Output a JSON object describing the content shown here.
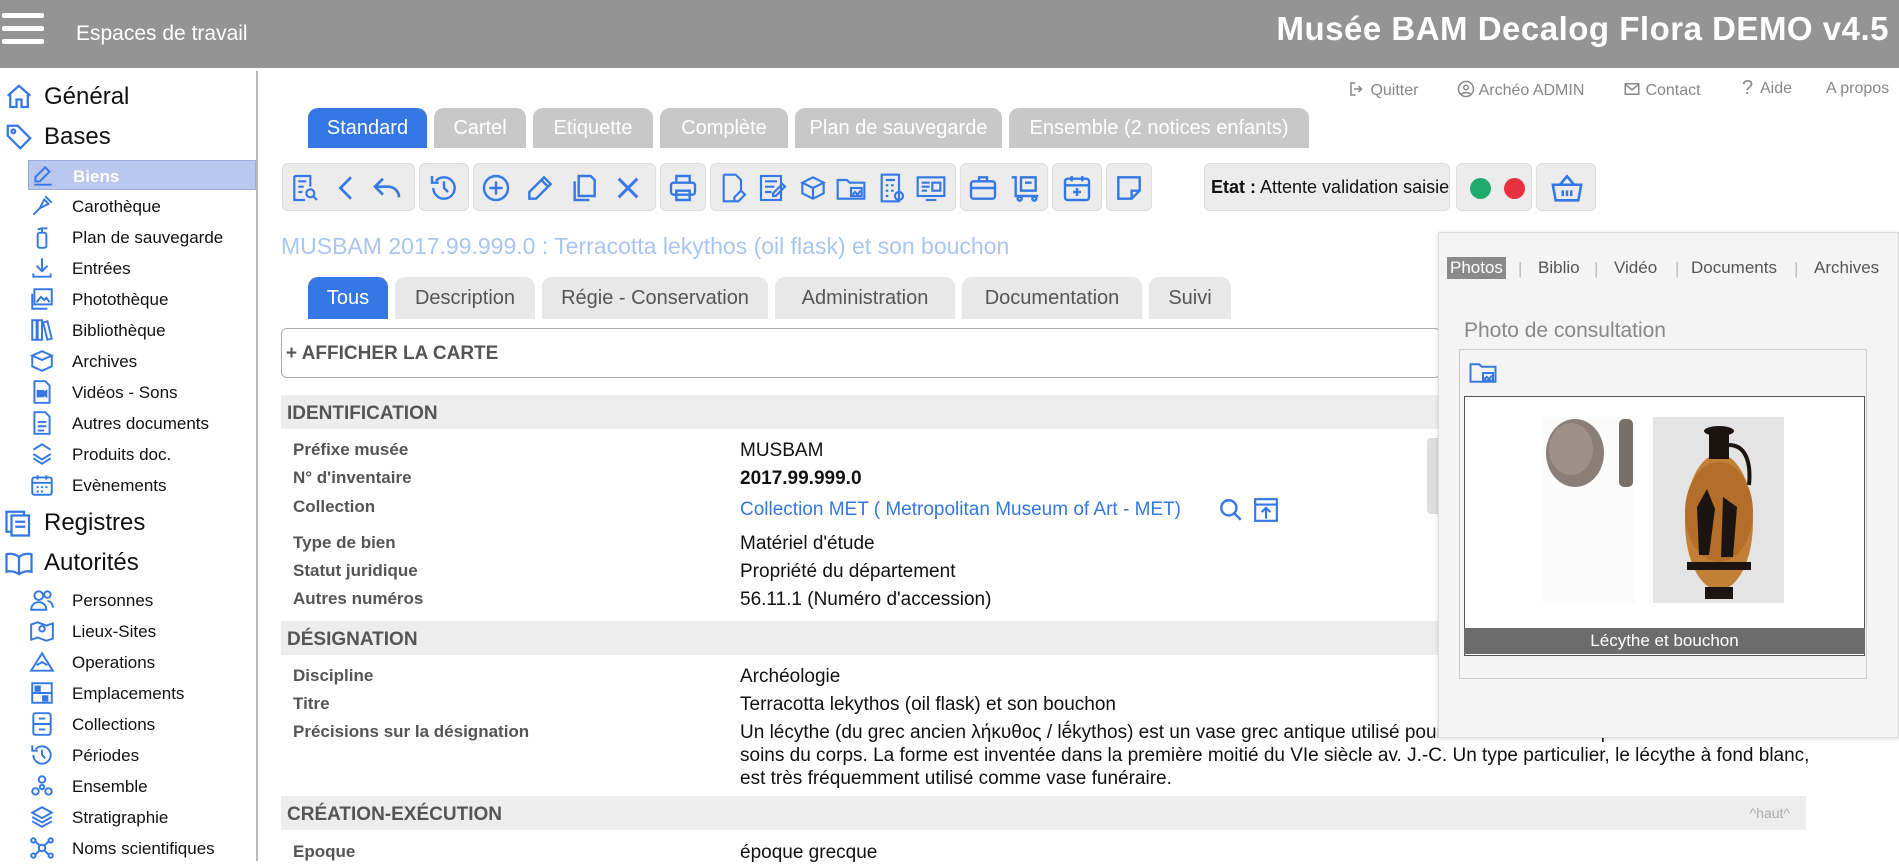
{
  "header": {
    "workspaces_label": "Espaces de travail",
    "app_title": "Musée BAM Decalog Flora DEMO v4.5"
  },
  "sidebar": {
    "sections": [
      {
        "label": "Général",
        "icon": "home-icon"
      },
      {
        "label": "Bases",
        "icon": "tag-icon"
      },
      {
        "label": "Registres",
        "icon": "registers-icon"
      },
      {
        "label": "Autorités",
        "icon": "book-open-icon"
      }
    ],
    "bases_items": [
      {
        "label": "Biens",
        "icon": "pen-edit-icon",
        "active": true
      },
      {
        "label": "Carothèque",
        "icon": "drill-icon"
      },
      {
        "label": "Plan de sauvegarde",
        "icon": "fire-extinguisher-icon"
      },
      {
        "label": "Entrées",
        "icon": "download-icon"
      },
      {
        "label": "Photothèque",
        "icon": "image-gallery-icon"
      },
      {
        "label": "Bibliothèque",
        "icon": "books-icon"
      },
      {
        "label": "Archives",
        "icon": "archive-box-icon"
      },
      {
        "label": "Vidéos - Sons",
        "icon": "video-file-icon"
      },
      {
        "label": "Autres documents",
        "icon": "document-icon"
      },
      {
        "label": "Produits doc.",
        "icon": "stack-icon"
      },
      {
        "label": "Evènements",
        "icon": "calendar-icon"
      }
    ],
    "autorites_items": [
      {
        "label": "Personnes",
        "icon": "people-icon"
      },
      {
        "label": "Lieux-Sites",
        "icon": "map-pin-icon"
      },
      {
        "label": "Operations",
        "icon": "excavation-icon"
      },
      {
        "label": "Emplacements",
        "icon": "shelves-icon"
      },
      {
        "label": "Collections",
        "icon": "cabinet-icon"
      },
      {
        "label": "Périodes",
        "icon": "history-icon"
      },
      {
        "label": "Ensemble",
        "icon": "cluster-icon"
      },
      {
        "label": "Stratigraphie",
        "icon": "layers-icon"
      },
      {
        "label": "Noms scientifiques",
        "icon": "network-icon"
      }
    ]
  },
  "top_links": {
    "quit": "Quitter",
    "user": "Archéo ADMIN",
    "contact": "Contact",
    "help": "Aide",
    "about": "A propos"
  },
  "view_tabs": [
    "Standard",
    "Cartel",
    "Etiquette",
    "Complète",
    "Plan de sauvegarde",
    "Ensemble (2 notices enfants)"
  ],
  "status": {
    "label": "Etat :",
    "value": "Attente validation saisie"
  },
  "record_title": "MUSBAM 2017.99.999.0 : Terracotta lekythos (oil flask) et son bouchon",
  "section_tabs": [
    "Tous",
    "Description",
    "Régie - Conservation",
    "Administration",
    "Documentation",
    "Suivi"
  ],
  "map_toggle": "+ AFFICHER LA CARTE",
  "identification": {
    "title": "IDENTIFICATION",
    "fields": [
      {
        "label": "Préfixe musée",
        "value": "MUSBAM"
      },
      {
        "label": "N° d'inventaire",
        "value": "2017.99.999.0"
      },
      {
        "label": "Collection",
        "value": "Collection MET ( Metropolitan Museum of Art - MET)"
      },
      {
        "label": "Type de bien",
        "value": "Matériel d'étude"
      },
      {
        "label": "Statut juridique",
        "value": "Propriété du département"
      },
      {
        "label": "Autres numéros",
        "value": "56.11.1  (Numéro d'accession)"
      }
    ]
  },
  "designation": {
    "title": "DÉSIGNATION",
    "fields": [
      {
        "label": "Discipline",
        "value": "Archéologie"
      },
      {
        "label": "Titre",
        "value": "Terracotta lekythos (oil flask) et son bouchon"
      },
      {
        "label": "Précisions sur la désignation",
        "value": "Un lécythe (du grec ancien λήκυθος / lḗkythos) est un vase grec antique utilisé pour contenir de l'huile parfumée destinée aux soins du corps. La forme est inventée dans la première moitié du VIe siècle av. J.-C. Un type particulier, le lécythe à fond blanc, est très fréquemment utilisé comme vase funéraire."
      }
    ]
  },
  "creation": {
    "title": "CRÉATION-EXÉCUTION",
    "top_link": "^haut^",
    "fields": [
      {
        "label": "Epoque",
        "value": "époque grecque"
      }
    ]
  },
  "media_panel": {
    "tabs": [
      "Photos",
      "Biblio",
      "Vidéo",
      "Documents",
      "Archives"
    ],
    "heading": "Photo de consultation",
    "caption": "Lécythe et bouchon"
  },
  "colors": {
    "accent": "#3578e5",
    "topbar": "#949494",
    "green": "#1fab6b",
    "red": "#e83040"
  }
}
